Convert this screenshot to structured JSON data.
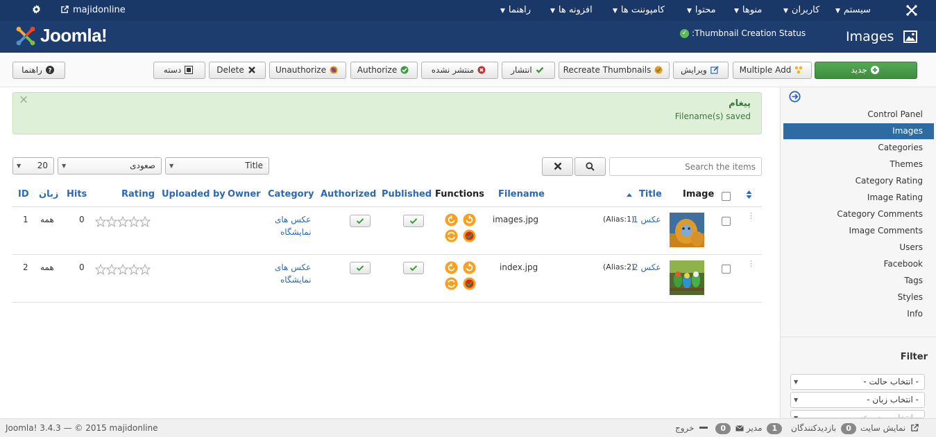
{
  "topnav": {
    "site_name": "majidonline",
    "menus": [
      "سیستم",
      "کاربران",
      "منوها",
      "محتوا",
      "کامپوننت ها",
      "افزونه ها",
      "راهنما"
    ]
  },
  "header": {
    "logo_text": "Joomla!",
    "thumbnail_status": ":Thumbnail Creation Status",
    "page_title": "Images"
  },
  "toolbar": {
    "new": "جدید",
    "multiple_add": "Multiple Add",
    "edit": "ویرایش",
    "recreate": "Recreate Thumbnails",
    "publish": "انتشار",
    "unpublish": "منتشر نشده",
    "authorize": "Authorize",
    "unauthorize": "Unauthorize",
    "delete": "Delete",
    "batch": "دسته",
    "help": "راهنما"
  },
  "sidebar": {
    "items": [
      {
        "label": "Control Panel",
        "active": false
      },
      {
        "label": "Images",
        "active": true
      },
      {
        "label": "Categories",
        "active": false
      },
      {
        "label": "Themes",
        "active": false
      },
      {
        "label": "Category Rating",
        "active": false
      },
      {
        "label": "Image Rating",
        "active": false
      },
      {
        "label": "Category Comments",
        "active": false
      },
      {
        "label": "Image Comments",
        "active": false
      },
      {
        "label": "Users",
        "active": false
      },
      {
        "label": "Facebook",
        "active": false
      },
      {
        "label": "Tags",
        "active": false
      },
      {
        "label": "Styles",
        "active": false
      },
      {
        "label": "Info",
        "active": false
      }
    ],
    "filter_title": "Filter",
    "filters": [
      "- انتخاب حالت -",
      "- انتخاب زبان -",
      "- انتخاب مجموعه -"
    ]
  },
  "message": {
    "heading": "پیغام",
    "text": "Filename(s) saved"
  },
  "filterbar": {
    "search_placeholder": "Search the items",
    "order_by": "Title",
    "direction": "صعودی",
    "limit": "20"
  },
  "table": {
    "headers": {
      "image": "Image",
      "title": "Title",
      "filename": "Filename",
      "functions": "Functions",
      "published": "Published",
      "authorized": "Authorized",
      "category": "Category",
      "owner": "Owner",
      "uploaded_by": "Uploaded by",
      "rating": "Rating",
      "hits": "Hits",
      "language": "زبان",
      "id": "ID"
    },
    "rows": [
      {
        "title": "عکس 1",
        "alias": "(Alias:1)",
        "filename": "images.jpg",
        "category_line1": "عکس های",
        "category_line2": "نمایشگاه",
        "hits": "0",
        "language": "همه",
        "id": "1",
        "thumb": "monkey"
      },
      {
        "title": "عکس 2",
        "alias": "(Alias:2)",
        "filename": "index.jpg",
        "category_line1": "عکس های",
        "category_line2": "نمایشگاه",
        "hits": "0",
        "language": "همه",
        "id": "2",
        "thumb": "parrots"
      }
    ]
  },
  "footer": {
    "view_site": "نمایش سایت",
    "visitors_count": "0",
    "visitors": "بازدیدکنندگان",
    "admins_count": "1",
    "admins": "مدیر",
    "messages_count": "0",
    "logout": "خروج",
    "copyright": "Joomla! 3.4.3 — © 2015 majidonline"
  },
  "colors": {
    "navbar": "#1a3867",
    "header": "#1c3d6e",
    "accent": "#2d6ca2",
    "success": "#dff0d8",
    "new_button": "#46a546"
  }
}
